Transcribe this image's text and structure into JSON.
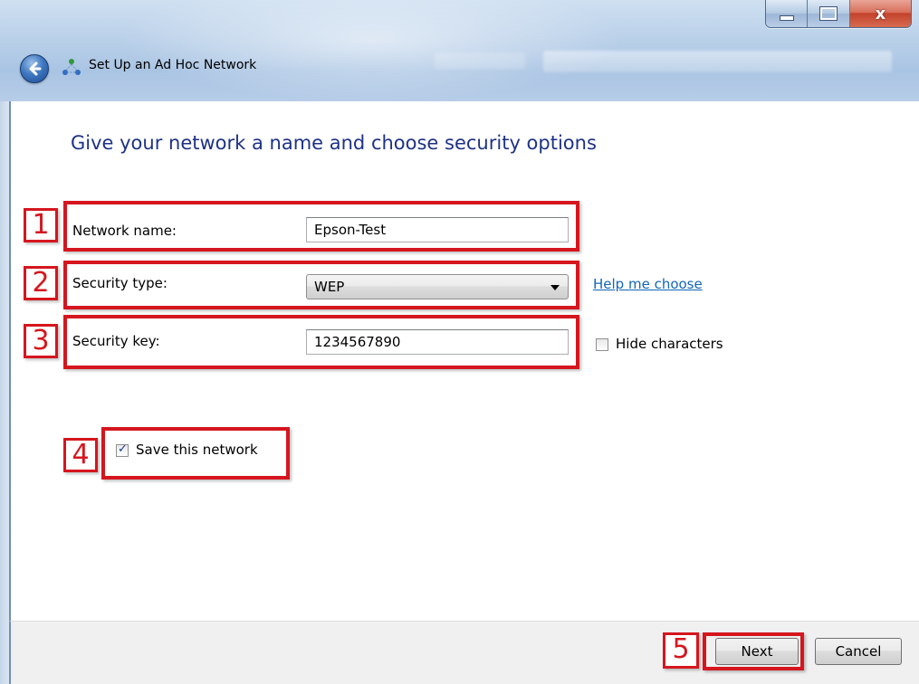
{
  "window": {
    "title": "Set Up an Ad Hoc Network",
    "controls": {
      "minimize": "minimize",
      "maximize": "maximize",
      "close": "x"
    }
  },
  "heading": "Give your network a name and choose security options",
  "form": {
    "network_name": {
      "label": "Network name:",
      "value": "Epson-Test"
    },
    "security_type": {
      "label": "Security type:",
      "value": "WEP",
      "help_link": "Help me choose"
    },
    "security_key": {
      "label": "Security key:",
      "value": "1234567890",
      "hide_characters_label": "Hide characters",
      "hide_characters_checked": false
    },
    "save_network": {
      "label": "Save this network",
      "checked": true
    }
  },
  "buttons": {
    "next": "Next",
    "cancel": "Cancel"
  },
  "annotations": [
    "1",
    "2",
    "3",
    "4",
    "5"
  ],
  "colors": {
    "annotation_red": "#d5161e",
    "heading_blue": "#1e3287",
    "link_blue": "#1166bb"
  },
  "icons": [
    "back-arrow-icon",
    "ad-hoc-network-icon",
    "minimize-icon",
    "maximize-icon",
    "close-icon",
    "dropdown-arrow-icon",
    "checkmark-icon"
  ]
}
